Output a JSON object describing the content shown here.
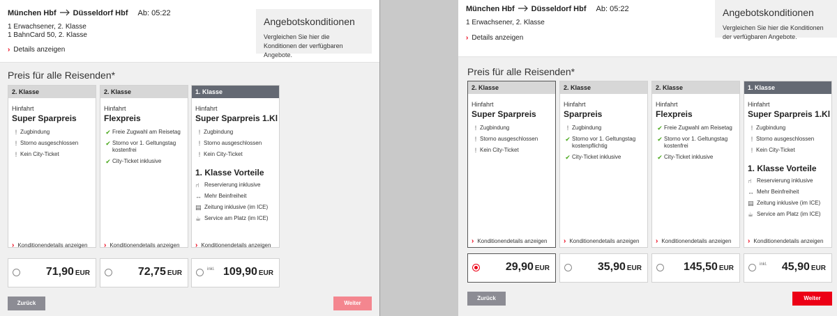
{
  "left": {
    "route_from": "München Hbf",
    "route_to": "Düsseldorf Hbf",
    "departure": "Ab: 05:22",
    "travellers": [
      "1 Erwachsener, 2. Klasse",
      "1 BahnCard 50, 2. Klasse"
    ],
    "details_link": "Details anzeigen",
    "offer_title": "Angebotskonditionen",
    "offer_text": "Vergleichen Sie hier die Konditionen der verfügbaren Angebote.",
    "section_title": "Preis für alle Reisenden*",
    "cards": [
      {
        "class": "2. Klasse",
        "direction": "Hinfahrt",
        "fare": "Super Sparpreis",
        "features": [
          {
            "icon": "warn",
            "text": "Zugbindung"
          },
          {
            "icon": "warn",
            "text": "Storno ausgeschlossen"
          },
          {
            "icon": "warn",
            "text": "Kein City-Ticket"
          }
        ],
        "conditions_link": "Konditionendetails anzeigen",
        "price": "71,90",
        "currency": "EUR"
      },
      {
        "class": "2. Klasse",
        "direction": "Hinfahrt",
        "fare": "Flexpreis",
        "features": [
          {
            "icon": "ok",
            "text": "Freie Zugwahl am Reisetag"
          },
          {
            "icon": "ok",
            "text": "Storno vor 1. Geltungstag kostenfrei"
          },
          {
            "icon": "ok",
            "text": "City-Ticket inklusive"
          }
        ],
        "conditions_link": "Konditionendetails anzeigen",
        "price": "72,75",
        "currency": "EUR"
      },
      {
        "class": "1. Klasse",
        "direction": "Hinfahrt",
        "fare": "Super Sparpreis 1.Kl",
        "features": [
          {
            "icon": "warn",
            "text": "Zugbindung"
          },
          {
            "icon": "warn",
            "text": "Storno ausgeschlossen"
          },
          {
            "icon": "warn",
            "text": "Kein City-Ticket"
          }
        ],
        "perks_title": "1. Klasse Vorteile",
        "perks": [
          {
            "icon": "seat-icon",
            "text": "Reservierung inklusive"
          },
          {
            "icon": "legroom-icon",
            "text": "Mehr Beinfreiheit"
          },
          {
            "icon": "newspaper-icon",
            "text": "Zeitung inklusive (im ICE)"
          },
          {
            "icon": "service-icon",
            "text": "Service am Platz (im ICE)"
          }
        ],
        "conditions_link": "Konditionendetails anzeigen",
        "price": "109,90",
        "currency": "EUR",
        "incl_label": "inkl."
      }
    ],
    "back_label": "Zurück",
    "next_label": "Weiter"
  },
  "right": {
    "route_from": "München Hbf",
    "route_to": "Düsseldorf Hbf",
    "departure": "Ab: 05:22",
    "travellers": [
      "1 Erwachsener, 2. Klasse"
    ],
    "details_link": "Details anzeigen",
    "offer_title": "Angebotskonditionen",
    "offer_text": "Vergleichen Sie hier die Konditionen der verfügbaren Angebote.",
    "section_title": "Preis für alle Reisenden*",
    "cards": [
      {
        "class": "2. Klasse",
        "direction": "Hinfahrt",
        "fare": "Super Sparpreis",
        "features": [
          {
            "icon": "warn",
            "text": "Zugbindung"
          },
          {
            "icon": "warn",
            "text": "Storno ausgeschlossen"
          },
          {
            "icon": "warn",
            "text": "Kein City-Ticket"
          }
        ],
        "conditions_link": "Konditionendetails anzeigen",
        "price": "29,90",
        "currency": "EUR",
        "selected": true
      },
      {
        "class": "2. Klasse",
        "direction": "Hinfahrt",
        "fare": "Sparpreis",
        "features": [
          {
            "icon": "warn",
            "text": "Zugbindung"
          },
          {
            "icon": "ok",
            "text": "Storno vor 1. Geltungstag kostenpflichtig"
          },
          {
            "icon": "ok",
            "text": "City-Ticket inklusive"
          }
        ],
        "conditions_link": "Konditionendetails anzeigen",
        "price": "35,90",
        "currency": "EUR"
      },
      {
        "class": "2. Klasse",
        "direction": "Hinfahrt",
        "fare": "Flexpreis",
        "features": [
          {
            "icon": "ok",
            "text": "Freie Zugwahl am Reisetag"
          },
          {
            "icon": "ok",
            "text": "Storno vor 1. Geltungstag kostenfrei"
          },
          {
            "icon": "ok",
            "text": "City-Ticket inklusive"
          }
        ],
        "conditions_link": "Konditionendetails anzeigen",
        "price": "145,50",
        "currency": "EUR"
      },
      {
        "class": "1. Klasse",
        "direction": "Hinfahrt",
        "fare": "Super Sparpreis 1.Kl",
        "features": [
          {
            "icon": "warn",
            "text": "Zugbindung"
          },
          {
            "icon": "warn",
            "text": "Storno ausgeschlossen"
          },
          {
            "icon": "warn",
            "text": "Kein City-Ticket"
          }
        ],
        "perks_title": "1. Klasse Vorteile",
        "perks": [
          {
            "icon": "seat-icon",
            "text": "Reservierung inklusive"
          },
          {
            "icon": "legroom-icon",
            "text": "Mehr Beinfreiheit"
          },
          {
            "icon": "newspaper-icon",
            "text": "Zeitung inklusive (im ICE)"
          },
          {
            "icon": "service-icon",
            "text": "Service am Platz (im ICE)"
          }
        ],
        "conditions_link": "Konditionendetails anzeigen",
        "price": "45,90",
        "currency": "EUR",
        "incl_label": "inkl."
      }
    ],
    "back_label": "Zurück",
    "next_label": "Weiter"
  }
}
